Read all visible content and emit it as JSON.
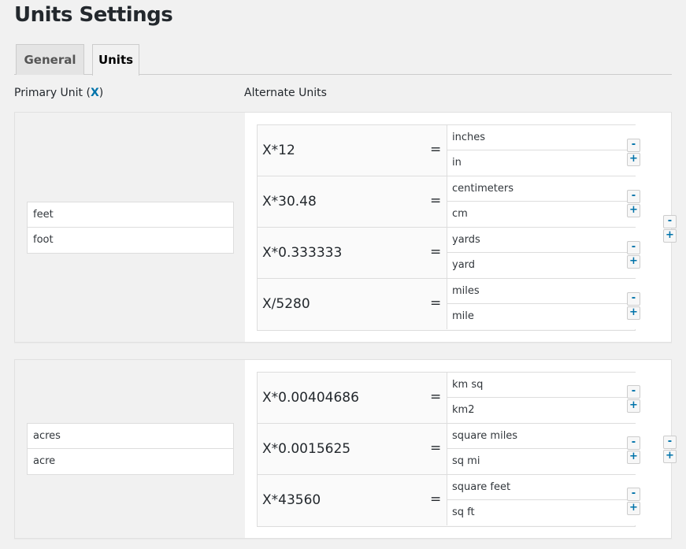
{
  "page": {
    "title": "Units Settings"
  },
  "tabs": [
    {
      "label": "General"
    },
    {
      "label": "Units"
    }
  ],
  "columns": {
    "primary_prefix": "Primary Unit (",
    "primary_var": "X",
    "primary_suffix": ")",
    "alternate": "Alternate Units"
  },
  "buttons": {
    "remove": "-",
    "add": "+"
  },
  "groups": [
    {
      "primary": [
        "feet",
        "foot"
      ],
      "alternates": [
        {
          "formula": "X*12",
          "eq": "=",
          "names": [
            "inches",
            "in"
          ]
        },
        {
          "formula": "X*30.48",
          "eq": "=",
          "names": [
            "centimeters",
            "cm"
          ]
        },
        {
          "formula": "X*0.333333",
          "eq": "=",
          "names": [
            "yards",
            "yard"
          ]
        },
        {
          "formula": "X/5280",
          "eq": "=",
          "names": [
            "miles",
            "mile"
          ]
        }
      ]
    },
    {
      "primary": [
        "acres",
        "acre"
      ],
      "alternates": [
        {
          "formula": "X*0.00404686",
          "eq": "=",
          "names": [
            "km sq",
            "km2"
          ]
        },
        {
          "formula": "X*0.0015625",
          "eq": "=",
          "names": [
            "square miles",
            "sq mi"
          ]
        },
        {
          "formula": "X*43560",
          "eq": "=",
          "names": [
            "square feet",
            "sq ft"
          ]
        }
      ]
    }
  ]
}
